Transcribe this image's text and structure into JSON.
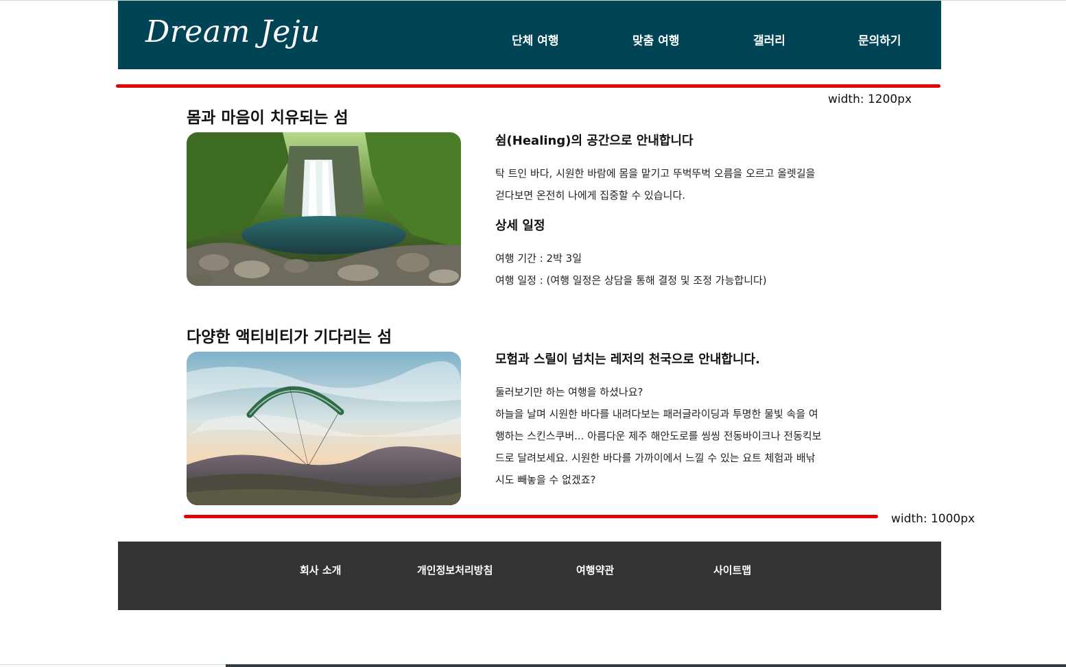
{
  "header": {
    "logo": "Dream Jeju",
    "nav": [
      {
        "label": "단체 여행"
      },
      {
        "label": "맞춤 여행"
      },
      {
        "label": "갤러리"
      },
      {
        "label": "문의하기"
      }
    ]
  },
  "annotations": {
    "top_width_label": "width: 1200px",
    "bottom_width_label": "width: 1000px",
    "line_color": "#e30000"
  },
  "sections": [
    {
      "title": "몸과 마음이 치유되는 섬",
      "image_icon": "waterfall-photo",
      "heading": "쉼(Healing)의 공간으로 안내합니다",
      "paragraph_lines": [
        "탁 트인 바다, 시원한 바람에 몸을 맡기고 뚜벅뚜벅 오름을 오르고 올렛길을",
        "걷다보면 온전히 나에게 집중할 수 있습니다."
      ],
      "detail_heading": "상세 일정",
      "details": [
        "여행 기간 : 2박 3일",
        "여행 일정 : (여행 일정은 상담을 통해 결정 및 조정 가능합니다)"
      ]
    },
    {
      "title": "다양한 액티비티가 기다리는 섬",
      "image_icon": "paragliding-photo",
      "heading": "모험과 스릴이 넘치는 레저의 천국으로 안내합니다.",
      "paragraph_lines": [
        "둘러보기만 하는 여행을 하셨나요?",
        "하늘을 날며 시원한 바다를 내려다보는 패러글라이딩과 투명한 물빛 속을 여",
        "행하는 스킨스쿠버... 아름다운 제주 해안도로를 씽씽 전동바이크나 전동킥보",
        "드로 달려보세요. 시원한 바다를 가까이에서 느낄 수 있는 요트 체험과 배낚",
        "시도 빼놓을 수 없겠죠?"
      ]
    }
  ],
  "footer": {
    "links": [
      {
        "label": "회사 소개"
      },
      {
        "label": "개인정보처리방침"
      },
      {
        "label": "여행약관"
      },
      {
        "label": "사이트맵"
      }
    ]
  },
  "colors": {
    "header_bg": "#004455",
    "footer_bg": "#333333"
  }
}
